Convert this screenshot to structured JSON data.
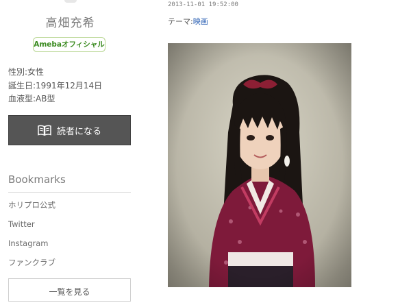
{
  "sidebar": {
    "blog_name": "高畑充希",
    "official_badge": "Amebaオフィシャル",
    "profile": {
      "gender": "性別:女性",
      "birthday": "誕生日:1991年12月14日",
      "blood_type": "血液型:AB型"
    },
    "reader_button": {
      "label": "読者になる",
      "icon": "book-icon"
    },
    "bookmarks": {
      "title": "Bookmarks",
      "items": [
        "ホリプロ公式",
        "Twitter",
        "Instagram",
        "ファンクラブ"
      ],
      "more_label": "一覧を見る"
    }
  },
  "post": {
    "date": "2013-11-01 19:52:00",
    "theme_label": "テーマ:",
    "theme_value": "映画",
    "photo": "photo"
  },
  "colors": {
    "reader_button_bg": "#555555",
    "theme_link": "#2a5fb3",
    "badge_text": "#3a8a1f",
    "badge_border": "#b6d58f"
  }
}
